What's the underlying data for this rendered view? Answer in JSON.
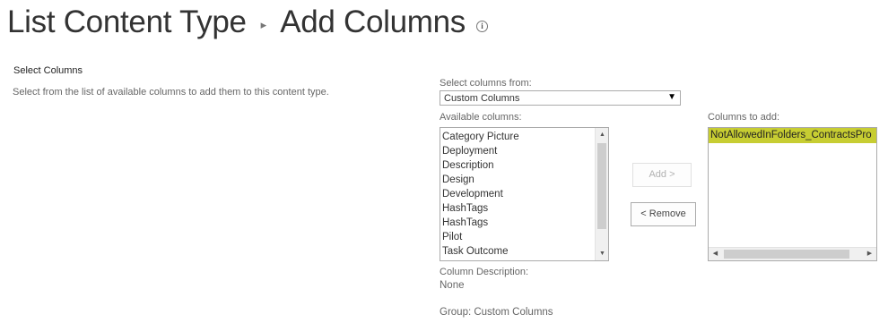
{
  "header": {
    "breadcrumb_root": "List Content Type",
    "page_title": "Add Columns"
  },
  "section": {
    "title": "Select Columns",
    "description": "Select from the list of available columns to add them to this content type."
  },
  "form": {
    "select_from_label": "Select columns from:",
    "select_from_value": "Custom Columns",
    "available_label": "Available columns:",
    "available_columns": [
      "Category Picture",
      "Deployment",
      "Description",
      "Design",
      "Development",
      "HashTags",
      "HashTags",
      "Pilot",
      "Task Outcome"
    ],
    "add_button": "Add >",
    "remove_button": "< Remove",
    "columns_to_add_label": "Columns to add:",
    "columns_to_add": [
      "NotAllowedInFolders_ContractsPro"
    ],
    "description_label": "Column Description:",
    "description_value": "None",
    "group_label": "Group: Custom Columns"
  },
  "colors": {
    "selected_highlight": "#c7cd32",
    "title_text": "#333333"
  },
  "icons": {
    "breadcrumb_separator": "triangle-right-icon",
    "info": "info-icon"
  }
}
